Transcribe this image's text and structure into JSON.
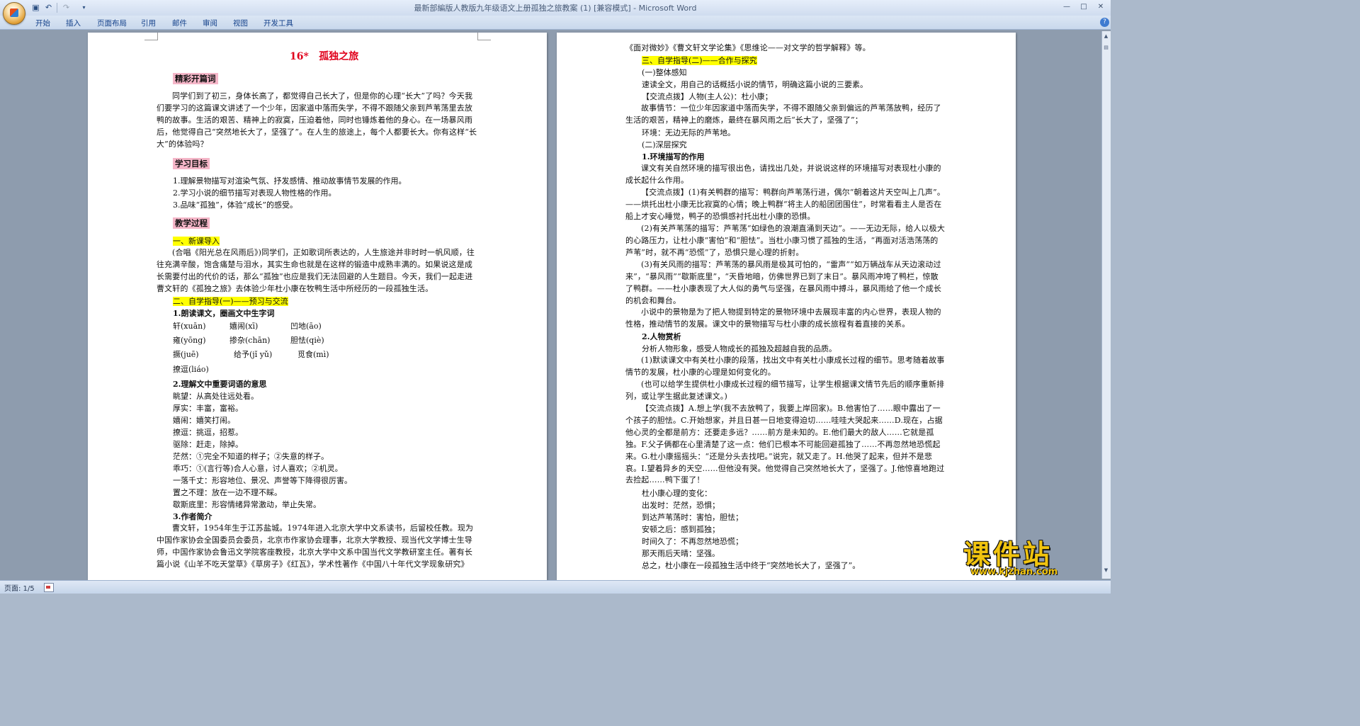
{
  "window": {
    "title": "最新部編版人教版九年级语文上册孤独之旅教案 (1) [兼容模式] - Microsoft Word",
    "minimize": "—",
    "maximize": "□",
    "close": "✕"
  },
  "qat": {
    "save_icon": "save-icon",
    "undo_icon": "undo-icon",
    "redo_icon": "redo-icon",
    "more": "▾"
  },
  "ribbon_tabs": [
    {
      "label": "开始"
    },
    {
      "label": "插入"
    },
    {
      "label": "页面布局"
    },
    {
      "label": "引用"
    },
    {
      "label": "邮件"
    },
    {
      "label": "审阅"
    },
    {
      "label": "视图"
    },
    {
      "label": "开发工具"
    }
  ],
  "help": "?",
  "status": {
    "page": "页面: 1/5"
  },
  "watermark": {
    "big": "课件站",
    "url": "www.kjzhan.com"
  },
  "page1": {
    "title_num": "16*",
    "title_text": "孤独之旅",
    "h1": "精彩开篇词",
    "intro": "同学们到了初三，身体长高了，都觉得自己长大了，但是你的心理“长大”了吗？今天我们要学习的这篇课文讲述了一个少年，因家道中落而失学，不得不跟随父亲到芦苇荡里去放鸭的故事。生活的艰苦、精神上的寂寞，压迫着他，同时也锤炼着他的身心。在一场暴风雨后，他觉得自己“突然地长大了，坚强了”。在人生的旅途上，每个人都要长大。你有这样“长大”的体验吗？",
    "h2": "学习目标",
    "goals": [
      "1.理解景物描写对渲染气氛、抒发感情、推动故事情节发展的作用。",
      "2.学习小说的细节描写对表现人物性格的作用。",
      "3.品味“孤独”，体验“成长”的感受。"
    ],
    "h3": "教学过程",
    "s1": "一、新课导入",
    "s1_text": "(合唱《阳光总在风雨后》)同学们，正如歌词所表达的，人生旅途并非时时一帆风顺，往往充满辛酸，饱含痛楚与泪水，其实生命也就是在这样的锻造中成熟丰满的。如果说这是成长需要付出的代价的话，那么“孤独”也应是我们无法回避的人生题目。今天，我们一起走进曹文轩的《孤独之旅》去体验少年杜小康在牧鸭生活中所经历的一段孤独生活。",
    "s2": "二、自学指导(一)——预习与交流",
    "q1": "1.朗读课文，圈画文中生字词",
    "words_row1": [
      "轩(xuān)",
      "嬉闹(xī)",
      "凹地(āo)"
    ],
    "words_row2": [
      "雍(yōng)",
      "掺杂(chān)",
      "胆怯(qiè)"
    ],
    "words_row3": [
      "撅(juē)",
      "给予(jǐ yǔ)",
      "觅食(mì)"
    ],
    "words_row4": [
      "撩逗(liáo)"
    ],
    "q2": "2.理解文中重要词语的意思",
    "defs": [
      "眺望：从高处往远处看。",
      "厚实：丰富，富裕。",
      "嬉闹：嬉笑打闹。",
      "撩逗：挑逗，招惹。",
      "驱除：赶走，除掉。",
      "茫然：①完全不知道的样子；②失意的样子。",
      "乖巧：①(言行等)合人心意，讨人喜欢；②机灵。",
      "一落千丈：形容地位、景况、声誉等下降得很厉害。",
      "置之不理：放在一边不理不睬。",
      "歇斯底里：形容情绪异常激动，举止失常。"
    ],
    "q3": "3.作者简介",
    "author": "曹文轩，1954年生于江苏盐城。1974年进入北京大学中文系读书，后留校任教。现为中国作家协会全国委员会委员，北京市作家协会理事，北京大学教授、现当代文学博士生导师，中国作家协会鲁迅文学院客座教授，北京大学中文系中国当代文学教研室主任。著有长篇小说《山羊不吃天堂草》《草房子》《红瓦》，学术性著作《中国八十年代文学现象研究》"
  },
  "page2": {
    "cont": "《面对微妙》《曹文轩文学论集》《思维论——对文学的哲学解释》等。",
    "s3": "三、自学指导(二)——合作与探究",
    "p1": "(一)整体感知",
    "p2": "速读全文，用自己的话概括小说的情节，明确这篇小说的三要素。",
    "p3": "【交流点拨】人物(主人公)：杜小康；",
    "p4": "故事情节：一位少年因家道中落而失学，不得不跟随父亲到偏远的芦苇荡放鸭，经历了生活的艰苦，精神上的磨炼，最终在暴风雨之后“长大了，坚强了”；",
    "p5": "环境：无边无际的芦苇地。",
    "p6": "(二)深层探究",
    "p7": "1.环境描写的作用",
    "p8": "课文有关自然环境的描写很出色，请找出几处，并说说这样的环境描写对表现杜小康的成长起什么作用。",
    "p9": "【交流点拨】(1)有关鸭群的描写：鸭群向芦苇荡行进，偶尔“朝着这片天空叫上几声”。——烘托出杜小康无比寂寞的心情；晚上鸭群“将主人的船团团围住”，时常看看主人是否在船上才安心睡觉，鸭子的恐惧感衬托出杜小康的恐惧。",
    "p10": "(2)有关芦苇荡的描写：芦苇荡“如绿色的浪潮直涌到天边”。——无边无际，给人以极大的心路压力，让杜小康“害怕”和“胆怯”。当杜小康习惯了孤独的生活，“再面对活浩荡荡的芦苇”时，就不再“恐慌”了，恐惧只是心理的折射。",
    "p11": "(3)有关风雨的描写：芦苇荡的暴风雨是极其可怕的，“雷声”“如万辆战车从天边滚动过来”，“暴风雨”“歇斯底里”，“天昏地暗，仿佛世界已到了末日”。暴风雨冲垮了鸭栏，惊散了鸭群。——杜小康表现了大人似的勇气与坚强，在暴风雨中搏斗，暴风雨给了他一个成长的机会和舞台。",
    "p12": "小说中的景物是为了把人物提到特定的景物环境中去展现丰富的内心世界，表现人物的性格，推动情节的发展。课文中的景物描写与杜小康的成长旅程有着直接的关系。",
    "p13": "2.人物赏析",
    "p14": "分析人物形象，感受人物成长的孤独及超越自我的品质。",
    "p15": "(1)默读课文中有关杜小康的段落，找出文中有关杜小康成长过程的细节。思考随着故事情节的发展，杜小康的心理是如何变化的。",
    "p16": "(也可以给学生提供杜小康成长过程的细节描写，让学生根据课文情节先后的顺序重新排列，或让学生据此复述课文。)",
    "p17": "【交流点拨】A.想上学(我不去放鸭了，我要上岸回家)。B.他害怕了……眼中露出了一个孩子的胆怯。C.开始想家，并且日甚一日地变得迫切……哇哇大哭起来……D.现在，占据他心灵的全都是前方：还要走多远？……前方是未知的。E.他们最大的敌人……它就是孤独。F.父子俩都在心里清楚了这一点：他们已根本不可能回避孤独了……不再忽然地恐慌起来。G.杜小康摇摇头：“还是分头去找吧。”说完，就又走了。H.他哭了起来，但并不是悲哀。I.望着异乡的天空……但他没有哭。他觉得自己突然地长大了，坚强了。J.他惊喜地跑过去捡起……鸭下蛋了！",
    "p18": "杜小康心理的变化：",
    "p19": "出发时：茫然，恐惧；",
    "p20": "到达芦苇荡时：害怕，胆怯；",
    "p21": "安顿之后：感到孤独；",
    "p22": "时间久了：不再忽然地恐慌；",
    "p23": "那天雨后天晴：坚强。",
    "p24": "总之，杜小康在一段孤独生活中终于“突然地长大了，坚强了”。"
  }
}
